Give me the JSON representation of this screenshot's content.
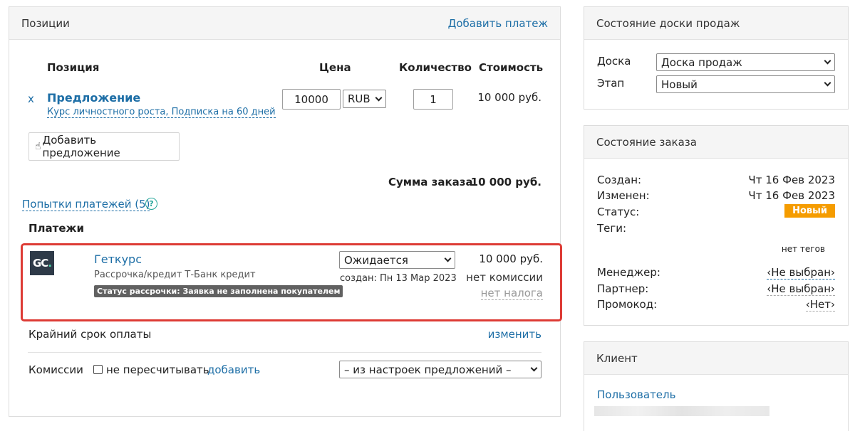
{
  "positions": {
    "title": "Позиции",
    "add_payment": "Добавить платеж",
    "columns": {
      "position": "Позиция",
      "price": "Цена",
      "quantity": "Количество",
      "cost": "Стоимость"
    },
    "item": {
      "remove": "x",
      "name": "Предложение",
      "subtitle": "Курс личностного роста, Подписка на 60 дней",
      "price": "10000",
      "currency": "RUB",
      "quantity": "1",
      "cost": "10 000 руб."
    },
    "add_offer": "Добавить предложение",
    "total_label": "Сумма заказа",
    "total_value": "10 000 руб.",
    "attempts_link": "Попытки платежей (5)",
    "help_symbol": "?",
    "payments_title": "Платежи",
    "payment": {
      "logo_text": "GC",
      "logo_dot": ".",
      "provider": "Геткурс",
      "method": "Рассрочка/кредит Т-Банк кредит",
      "status_badge": "Статус рассрочки: Заявка не заполнена покупателем",
      "status_select": "Ожидается",
      "created": "создан: Пн 13 Мар 2023",
      "amount": "10 000 руб.",
      "commission": "нет комиссии",
      "tax": "нет налога"
    },
    "deadline_label": "Крайний срок оплаты",
    "deadline_change": "изменить",
    "commissions_label": "Комиссии",
    "no_recalc": "не пересчитывать",
    "add_link": "добавить",
    "commission_select": "– из настроек предложений –"
  },
  "board": {
    "title": "Состояние доски продаж",
    "board_label": "Доска",
    "board_value": "Доска продаж",
    "stage_label": "Этап",
    "stage_value": "Новый"
  },
  "order": {
    "title": "Состояние заказа",
    "created_label": "Создан:",
    "created_value": "Чт 16 Фев 2023",
    "changed_label": "Изменен:",
    "changed_value": "Чт 16 Фев 2023",
    "status_label": "Статус:",
    "status_value": "Новый",
    "tags_label": "Теги:",
    "no_tags": "нет тегов",
    "manager_label": "Менеджер:",
    "manager_value": "‹Не выбран›",
    "partner_label": "Партнер:",
    "partner_value": "‹Не выбран›",
    "promo_label": "Промокод:",
    "promo_value": "‹Нет›"
  },
  "client": {
    "title": "Клиент",
    "user_link": "Пользователь"
  },
  "colors": {
    "link": "#1d6ea6",
    "highlight": "#dd3b35",
    "status": "#f59c00",
    "accent": "#26a69a"
  }
}
